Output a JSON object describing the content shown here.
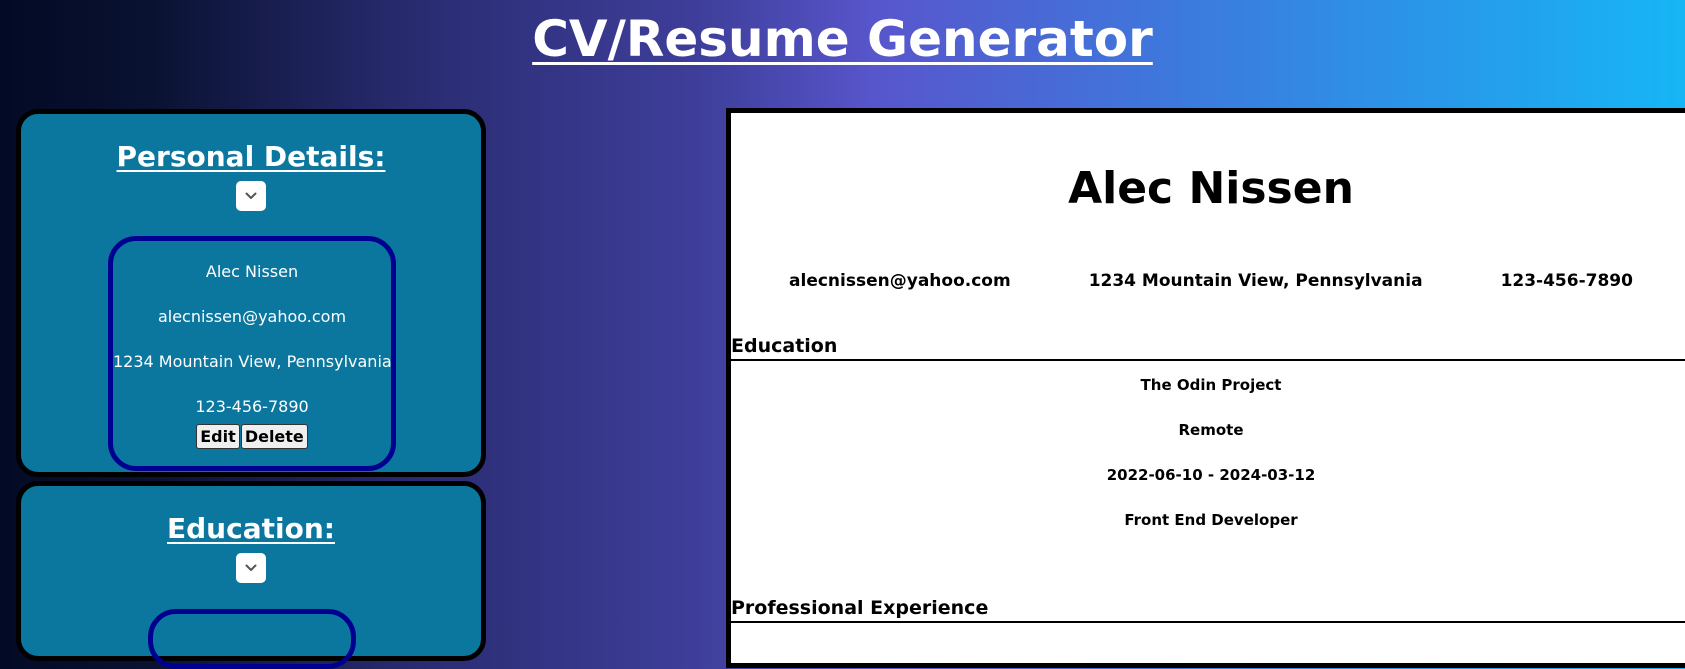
{
  "app": {
    "title": "CV/Resume Generator"
  },
  "personal_panel": {
    "heading": "Personal Details:",
    "toggle_icon": "chevron-down-icon",
    "entry": {
      "name": "Alec Nissen",
      "email": "alecnissen@yahoo.com",
      "address": "1234 Mountain View, Pennsylvania",
      "phone": "123-456-7890",
      "edit_label": "Edit",
      "delete_label": "Delete"
    }
  },
  "education_panel": {
    "heading": "Education:",
    "toggle_icon": "chevron-down-icon"
  },
  "resume": {
    "name": "Alec Nissen",
    "email": "alecnissen@yahoo.com",
    "address": "1234 Mountain View, Pennsylvania",
    "phone": "123-456-7890",
    "education_heading": "Education",
    "education": {
      "school": "The Odin Project",
      "location": "Remote",
      "dates": "2022-06-10 - 2024-03-12",
      "title": "Front End Developer"
    },
    "experience_heading": "Professional Experience"
  },
  "colors": {
    "panel_bg": "#0b779f",
    "card_border": "#000090",
    "gradient_start": "#030a25",
    "gradient_mid": "#5856cc",
    "gradient_end": "#16b6f5"
  }
}
